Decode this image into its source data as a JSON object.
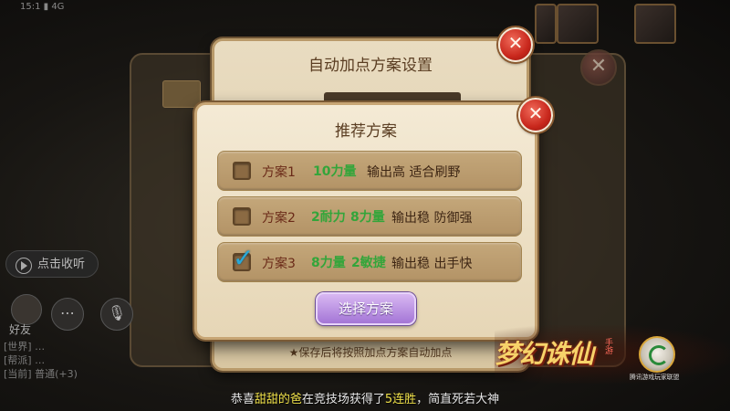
{
  "background": {
    "voice_label": "点击收听",
    "friend_label": "好友",
    "chat_lines": [
      "[世界] …",
      "[帮派] …",
      "[当前] 普通(+3)"
    ]
  },
  "middle_dialog": {
    "title": "自动加点方案设置",
    "hint": "★保存后将按照加点方案自动加点"
  },
  "recommend_dialog": {
    "title": "推荐方案",
    "plans": [
      {
        "name": "方案1",
        "stat_a": "10力量",
        "stat_b": "",
        "desc": "输出高 适合刷野",
        "checked": false
      },
      {
        "name": "方案2",
        "stat_a": "2耐力",
        "stat_b": "8力量",
        "desc": "输出稳 防御强",
        "checked": false
      },
      {
        "name": "方案3",
        "stat_a": "8力量",
        "stat_b": "2敏捷",
        "desc": "输出稳 出手快",
        "checked": true
      }
    ],
    "select_button": "选择方案"
  },
  "close_glyph": "✕",
  "check_glyph": "✓",
  "logo": {
    "title": "梦幻诛仙",
    "sub": "手游",
    "seal_caption": "腾讯游戏玩家联盟"
  },
  "broadcast": {
    "prefix": "恭喜",
    "player": "甜甜的爸",
    "middle": "在竞技场获得了",
    "highlight": "5连胜",
    "suffix": "，简直死若大神"
  },
  "colors": {
    "stat_green": "#33a53a",
    "plan_name": "#6a2a18",
    "button_purple": "#a476d6",
    "close_red": "#c8271c"
  }
}
